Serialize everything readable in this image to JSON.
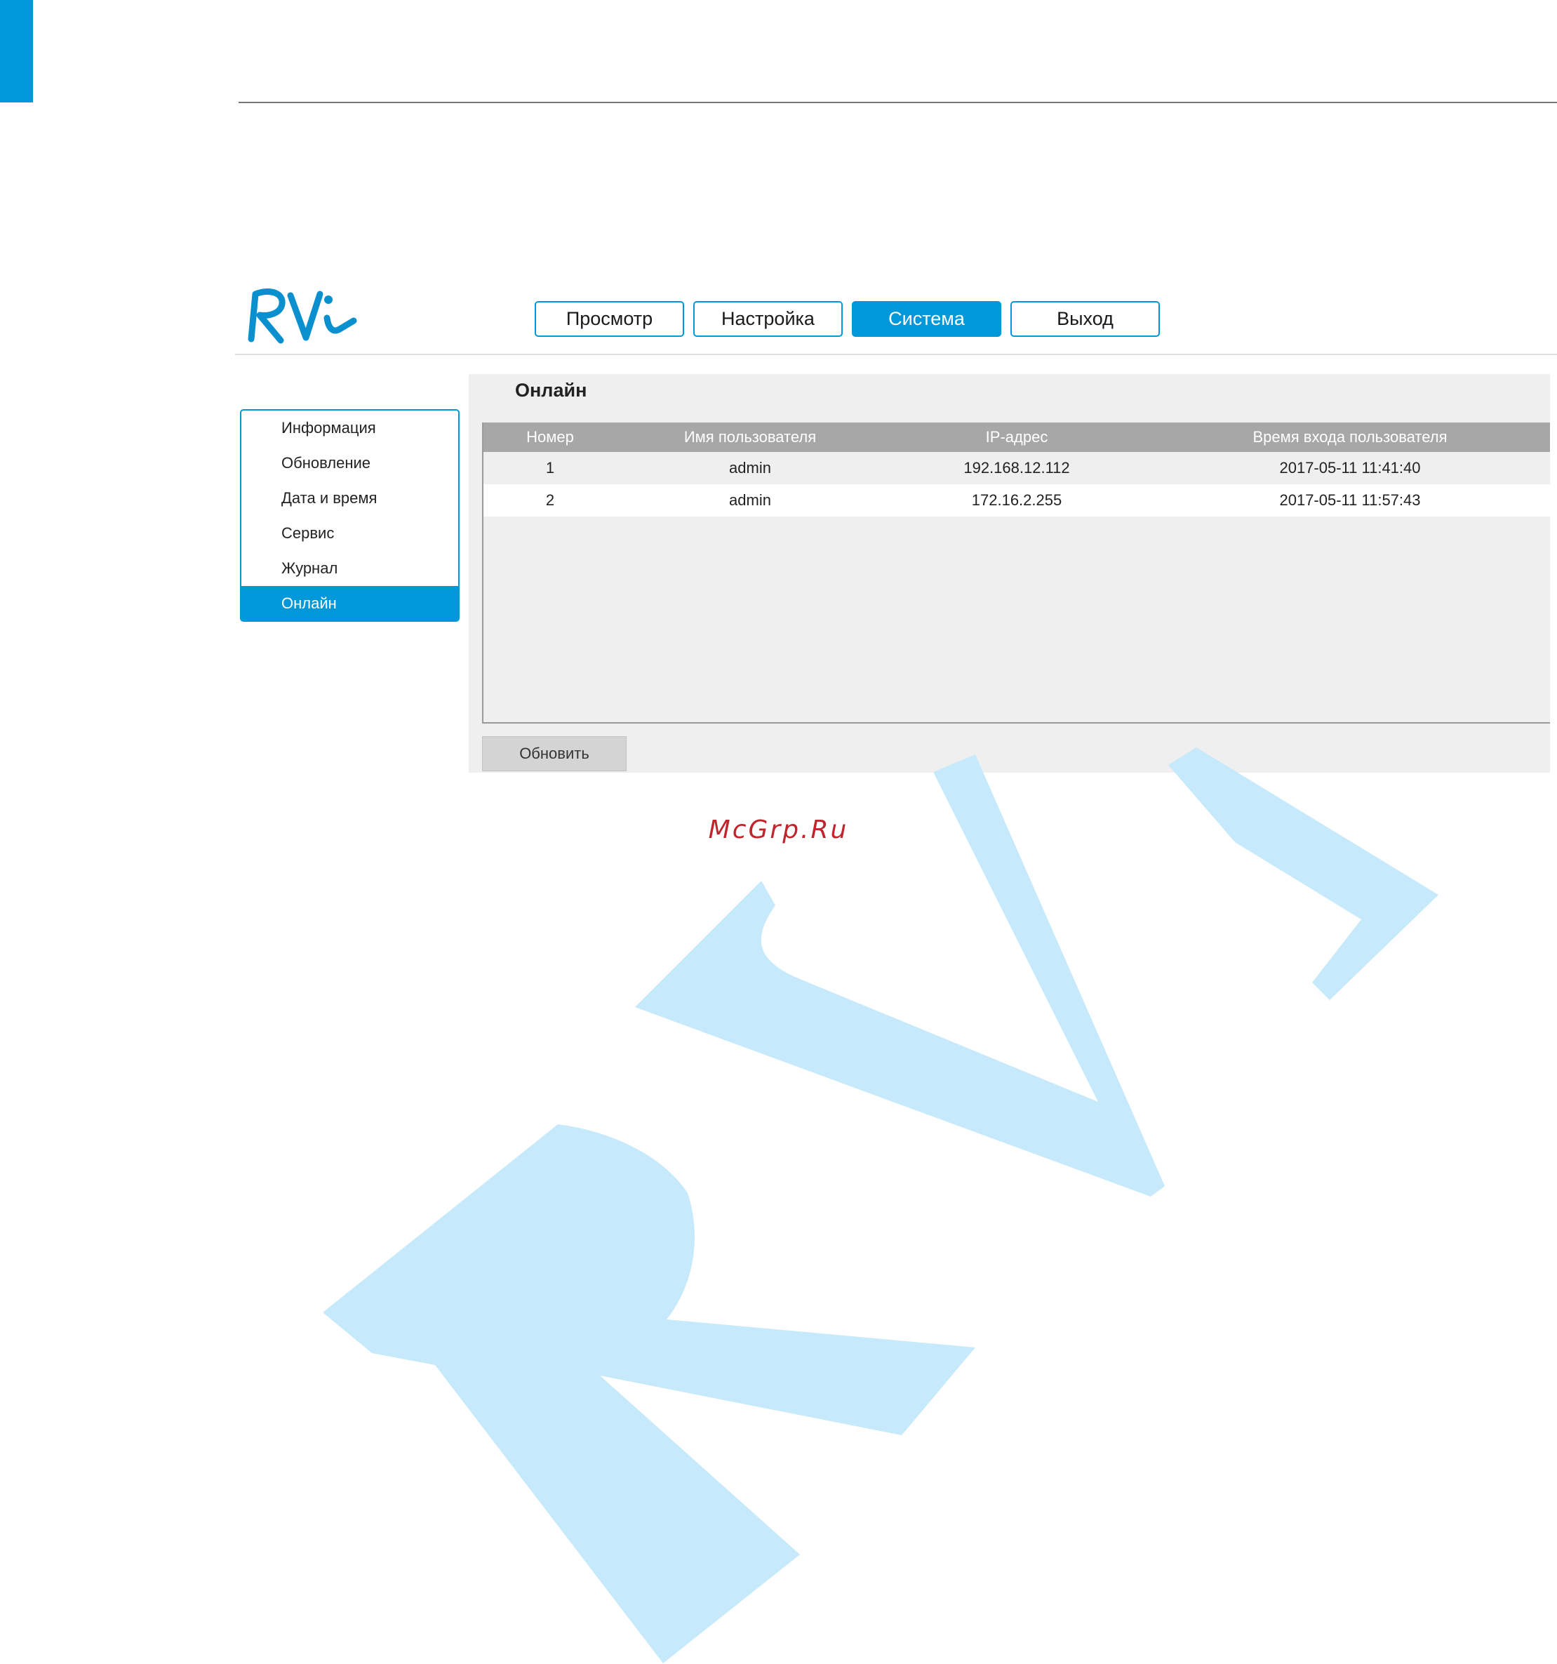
{
  "nav": [
    {
      "label": "Просмотр",
      "active": false
    },
    {
      "label": "Настройка",
      "active": false
    },
    {
      "label": "Система",
      "active": true
    },
    {
      "label": "Выход",
      "active": false
    }
  ],
  "sidebar": {
    "items": [
      {
        "label": "Информация"
      },
      {
        "label": "Обновление"
      },
      {
        "label": "Дата и время"
      },
      {
        "label": "Сервис"
      },
      {
        "label": "Журнал"
      },
      {
        "label": "Онлайн",
        "active": true
      }
    ]
  },
  "panel": {
    "title": "Онлайн",
    "columns": [
      "Номер",
      "Имя пользователя",
      "IP-адрес",
      "Время входа пользователя"
    ],
    "rows": [
      [
        "1",
        "admin",
        "192.168.12.112",
        "2017-05-11 11:41:40"
      ],
      [
        "2",
        "admin",
        "172.16.2.255",
        "2017-05-11 11:57:43"
      ]
    ],
    "refresh_label": "Обновить"
  },
  "watermark": {
    "site": "McGrp.Ru"
  },
  "colors": {
    "accent": "#0098d8",
    "watermark": "#c6e9fb",
    "table_header": "#a7a7a7",
    "panel_bg": "#efefef"
  }
}
